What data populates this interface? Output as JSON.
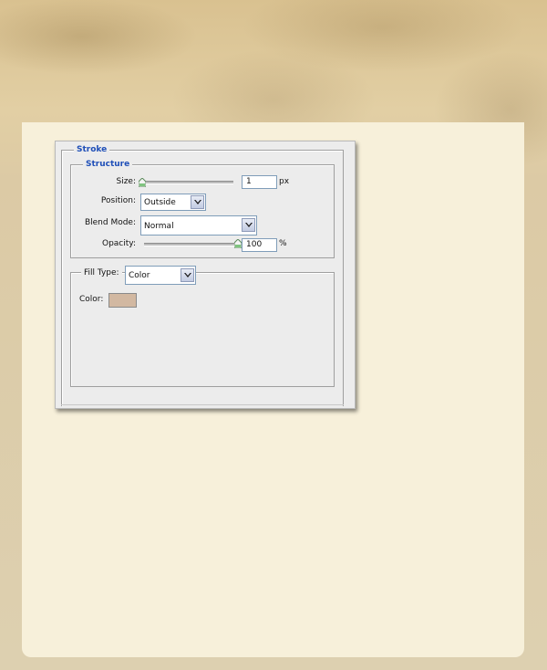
{
  "stroke": {
    "title": "Stroke",
    "structure": {
      "title": "Structure",
      "size": {
        "label": "Size:",
        "value": "1",
        "unit": "px",
        "slider_fraction": 0.0
      },
      "position": {
        "label": "Position:",
        "selected": "Outside"
      },
      "blend_mode": {
        "label": "Blend Mode:",
        "selected": "Normal"
      },
      "opacity": {
        "label": "Opacity:",
        "value": "100",
        "unit": "%",
        "slider_fraction": 1.0
      }
    },
    "fill": {
      "type_label": "Fill Type:",
      "type_selected": "Color",
      "color_label": "Color:",
      "color_value": "#d2b8a1"
    }
  },
  "colors": {
    "group_title": "#1f4fb8",
    "dialog_bg": "#ececec",
    "panel_bg": "#f7f0da"
  }
}
